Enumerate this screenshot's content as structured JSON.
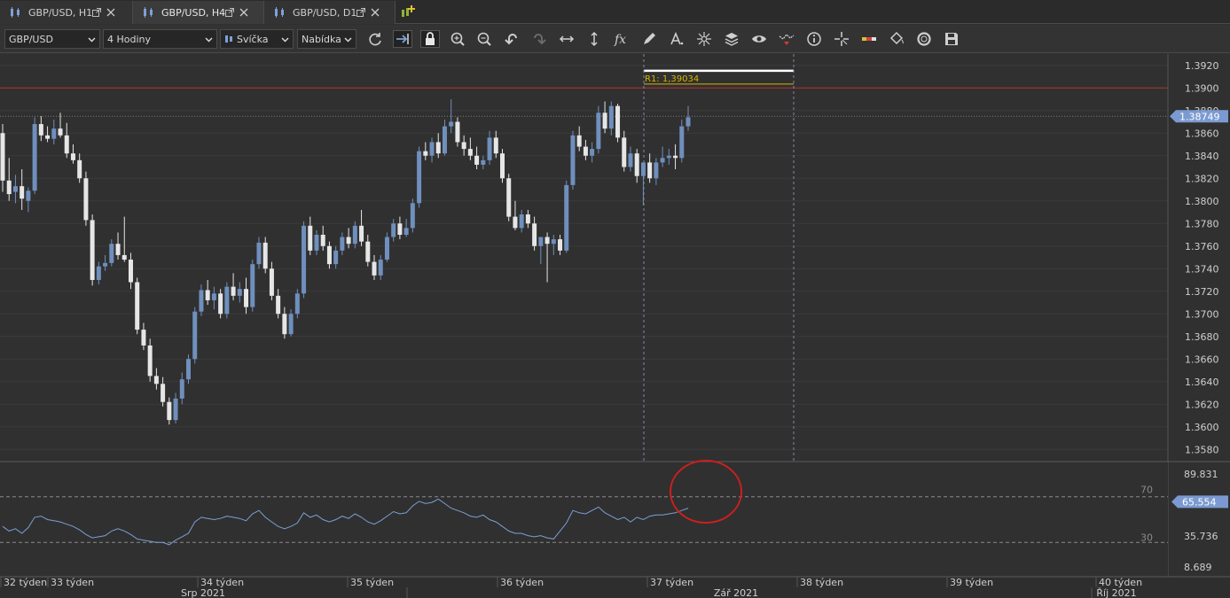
{
  "tabs": [
    {
      "label": "GBP/USD, H1",
      "active": false
    },
    {
      "label": "GBP/USD, H4",
      "active": true
    },
    {
      "label": "GBP/USD, D1",
      "active": false
    }
  ],
  "toolbar": {
    "instrument": "GBP/USD",
    "period": "4 Hodiny",
    "chart_type": "Svíčka",
    "price_side": "Nabídka",
    "icons": [
      "refresh-icon",
      "shift-chart-icon",
      "lock-icon",
      "zoom-in-icon",
      "zoom-out-icon",
      "undo-icon",
      "redo-icon",
      "horizontal-arrows-icon",
      "vertical-arrows-icon",
      "function-icon",
      "pencil-icon",
      "text-icon",
      "crosshair-star-icon",
      "layers-icon",
      "eye-icon",
      "indicator-alert-icon",
      "info-icon",
      "cursor-cross-icon",
      "color-bar-icon",
      "paint-bucket-icon",
      "target-ring-icon",
      "save-icon"
    ]
  },
  "colors": {
    "background": "#303030",
    "bull_candle": "#6f8fbd",
    "bear_candle": "#e6e6e6",
    "resistance_line": "#d9b300",
    "red_level": "#b03030",
    "rsi_line": "#7c9fd4",
    "highlight_circle": "#cc1f1f",
    "price_badge": "#7b9ad1"
  },
  "price_axis": {
    "labels": [
      "1.3920",
      "1.3900",
      "1.3880",
      "1.3860",
      "1.3840",
      "1.3820",
      "1.3800",
      "1.3780",
      "1.3760",
      "1.3740",
      "1.3720",
      "1.3700",
      "1.3680",
      "1.3660",
      "1.3640",
      "1.3620",
      "1.3600",
      "1.3580"
    ],
    "current_price": "1.38749"
  },
  "resistance": {
    "label": "R1: 1,39034"
  },
  "red_level_value": 1.39,
  "rsi": {
    "level_high": "70",
    "level_low": "30",
    "axis_labels": [
      "89.831",
      "35.736",
      "8.689"
    ],
    "current_value": "65.554"
  },
  "time_axis": {
    "weeks": [
      "32 týden",
      "33 týden",
      "34 týden",
      "35 týden",
      "36 týden",
      "37 týden",
      "38 týden",
      "39 týden",
      "40 týden"
    ],
    "months": [
      "Srp 2021",
      "Zář 2021",
      "Říj 2021"
    ]
  },
  "chart_data": {
    "type": "candlestick",
    "instrument": "GBP/USD",
    "timeframe": "4 Hodiny",
    "ylim": [
      1.357,
      1.393
    ],
    "candles": [
      [
        1.386,
        1.3868,
        1.3808,
        1.3818
      ],
      [
        1.3818,
        1.3838,
        1.38,
        1.3806
      ],
      [
        1.3808,
        1.3823,
        1.3798,
        1.3813
      ],
      [
        1.3813,
        1.3828,
        1.3792,
        1.3802
      ],
      [
        1.38,
        1.3812,
        1.379,
        1.3809
      ],
      [
        1.3809,
        1.3874,
        1.3806,
        1.3868
      ],
      [
        1.3868,
        1.3875,
        1.3853,
        1.3858
      ],
      [
        1.3858,
        1.3866,
        1.3852,
        1.3855
      ],
      [
        1.3855,
        1.3872,
        1.385,
        1.3864
      ],
      [
        1.3864,
        1.3878,
        1.3856,
        1.3858
      ],
      [
        1.3858,
        1.3869,
        1.3838,
        1.3842
      ],
      [
        1.3842,
        1.385,
        1.3833,
        1.3836
      ],
      [
        1.3836,
        1.3842,
        1.3816,
        1.382
      ],
      [
        1.382,
        1.3826,
        1.3778,
        1.3783
      ],
      [
        1.3783,
        1.3788,
        1.3725,
        1.373
      ],
      [
        1.373,
        1.3746,
        1.3726,
        1.3742
      ],
      [
        1.3742,
        1.3752,
        1.3738,
        1.3745
      ],
      [
        1.3745,
        1.3766,
        1.3742,
        1.3762
      ],
      [
        1.3762,
        1.3772,
        1.3748,
        1.3752
      ],
      [
        1.3752,
        1.3786,
        1.3746,
        1.3748
      ],
      [
        1.3748,
        1.3754,
        1.3722,
        1.3728
      ],
      [
        1.3728,
        1.3732,
        1.3682,
        1.3686
      ],
      [
        1.3686,
        1.3692,
        1.3668,
        1.3672
      ],
      [
        1.3672,
        1.3678,
        1.364,
        1.3645
      ],
      [
        1.3645,
        1.3652,
        1.3633,
        1.3638
      ],
      [
        1.3638,
        1.3644,
        1.3618,
        1.3622
      ],
      [
        1.3622,
        1.3626,
        1.3602,
        1.3606
      ],
      [
        1.3606,
        1.363,
        1.3603,
        1.3625
      ],
      [
        1.3625,
        1.3648,
        1.362,
        1.3642
      ],
      [
        1.3642,
        1.3664,
        1.3638,
        1.366
      ],
      [
        1.366,
        1.3706,
        1.3656,
        1.3702
      ],
      [
        1.3702,
        1.3726,
        1.3698,
        1.3721
      ],
      [
        1.3721,
        1.373,
        1.3708,
        1.3712
      ],
      [
        1.3712,
        1.3724,
        1.3704,
        1.3718
      ],
      [
        1.3718,
        1.3722,
        1.3696,
        1.37
      ],
      [
        1.37,
        1.3728,
        1.3696,
        1.3724
      ],
      [
        1.3724,
        1.3736,
        1.3712,
        1.3716
      ],
      [
        1.3716,
        1.3728,
        1.371,
        1.3722
      ],
      [
        1.3722,
        1.3732,
        1.37,
        1.3706
      ],
      [
        1.3706,
        1.3748,
        1.3702,
        1.3744
      ],
      [
        1.3744,
        1.3768,
        1.374,
        1.3763
      ],
      [
        1.3763,
        1.3768,
        1.3736,
        1.374
      ],
      [
        1.374,
        1.3746,
        1.3712,
        1.3716
      ],
      [
        1.3716,
        1.3722,
        1.3696,
        1.37
      ],
      [
        1.37,
        1.3706,
        1.3678,
        1.3682
      ],
      [
        1.3682,
        1.3704,
        1.368,
        1.37
      ],
      [
        1.37,
        1.3722,
        1.3696,
        1.3718
      ],
      [
        1.3718,
        1.3782,
        1.3714,
        1.3778
      ],
      [
        1.3778,
        1.3786,
        1.3752,
        1.3756
      ],
      [
        1.3756,
        1.3774,
        1.3752,
        1.377
      ],
      [
        1.377,
        1.3778,
        1.3756,
        1.376
      ],
      [
        1.376,
        1.3764,
        1.374,
        1.3744
      ],
      [
        1.3744,
        1.376,
        1.374,
        1.3756
      ],
      [
        1.3756,
        1.3772,
        1.3752,
        1.3768
      ],
      [
        1.3768,
        1.3776,
        1.3758,
        1.3762
      ],
      [
        1.3762,
        1.3782,
        1.3758,
        1.3778
      ],
      [
        1.3778,
        1.3792,
        1.376,
        1.3764
      ],
      [
        1.3764,
        1.377,
        1.3742,
        1.3746
      ],
      [
        1.3746,
        1.3752,
        1.373,
        1.3734
      ],
      [
        1.3734,
        1.3752,
        1.373,
        1.3748
      ],
      [
        1.3748,
        1.3772,
        1.3746,
        1.3768
      ],
      [
        1.3768,
        1.3784,
        1.3764,
        1.378
      ],
      [
        1.378,
        1.3786,
        1.3766,
        1.377
      ],
      [
        1.377,
        1.3784,
        1.3768,
        1.3776
      ],
      [
        1.3776,
        1.3802,
        1.3772,
        1.3798
      ],
      [
        1.3798,
        1.3848,
        1.3794,
        1.3844
      ],
      [
        1.3844,
        1.3852,
        1.3836,
        1.384
      ],
      [
        1.384,
        1.3856,
        1.3834,
        1.3852
      ],
      [
        1.3852,
        1.386,
        1.3838,
        1.3842
      ],
      [
        1.3842,
        1.3872,
        1.384,
        1.3866
      ],
      [
        1.3866,
        1.389,
        1.386,
        1.387
      ],
      [
        1.387,
        1.3874,
        1.3848,
        1.3852
      ],
      [
        1.3852,
        1.3858,
        1.384,
        1.3846
      ],
      [
        1.3846,
        1.3856,
        1.3836,
        1.384
      ],
      [
        1.384,
        1.3848,
        1.3828,
        1.3832
      ],
      [
        1.3832,
        1.384,
        1.3828,
        1.3836
      ],
      [
        1.3836,
        1.3862,
        1.3832,
        1.3856
      ],
      [
        1.3856,
        1.3862,
        1.3838,
        1.3842
      ],
      [
        1.3842,
        1.3846,
        1.3816,
        1.382
      ],
      [
        1.382,
        1.3824,
        1.3782,
        1.3786
      ],
      [
        1.3786,
        1.38,
        1.3774,
        1.3776
      ],
      [
        1.3776,
        1.3792,
        1.3772,
        1.3788
      ],
      [
        1.3788,
        1.3792,
        1.3776,
        1.378
      ],
      [
        1.378,
        1.3786,
        1.3756,
        1.376
      ],
      [
        1.376,
        1.3766,
        1.3744,
        1.3768
      ],
      [
        1.3768,
        1.3772,
        1.3728,
        1.3762
      ],
      [
        1.3762,
        1.377,
        1.3752,
        1.3766
      ],
      [
        1.3766,
        1.377,
        1.3752,
        1.3756
      ],
      [
        1.3756,
        1.3818,
        1.3754,
        1.3814
      ],
      [
        1.3814,
        1.3862,
        1.381,
        1.3858
      ],
      [
        1.3858,
        1.3866,
        1.3844,
        1.3848
      ],
      [
        1.3848,
        1.3854,
        1.3836,
        1.384
      ],
      [
        1.384,
        1.3852,
        1.3834,
        1.3846
      ],
      [
        1.3846,
        1.3884,
        1.3842,
        1.3878
      ],
      [
        1.3878,
        1.3888,
        1.386,
        1.3864
      ],
      [
        1.3864,
        1.3888,
        1.3858,
        1.3884
      ],
      [
        1.3884,
        1.3886,
        1.3852,
        1.3856
      ],
      [
        1.3856,
        1.3862,
        1.3826,
        1.383
      ],
      [
        1.383,
        1.3848,
        1.3826,
        1.3842
      ],
      [
        1.3842,
        1.3846,
        1.3816,
        1.3822
      ],
      [
        1.3822,
        1.383,
        1.3796,
        1.3834
      ],
      [
        1.3834,
        1.3842,
        1.3816,
        1.382
      ],
      [
        1.382,
        1.3838,
        1.3814,
        1.3834
      ],
      [
        1.3834,
        1.3848,
        1.383,
        1.3838
      ],
      [
        1.3838,
        1.3846,
        1.3832,
        1.384
      ],
      [
        1.384,
        1.385,
        1.3828,
        1.3838
      ],
      [
        1.3838,
        1.3872,
        1.3834,
        1.3866
      ],
      [
        1.3866,
        1.3884,
        1.3862,
        1.3874
      ]
    ],
    "rsi_values": [
      44,
      40,
      42,
      38,
      43,
      52,
      53,
      50,
      49,
      48,
      46,
      44,
      41,
      37,
      34,
      35,
      36,
      40,
      42,
      40,
      37,
      33,
      32,
      31,
      30,
      30,
      28,
      32,
      35,
      38,
      48,
      52,
      51,
      50,
      51,
      53,
      52,
      51,
      49,
      55,
      58,
      52,
      48,
      44,
      42,
      44,
      47,
      56,
      52,
      54,
      50,
      48,
      50,
      53,
      51,
      55,
      52,
      48,
      46,
      49,
      53,
      57,
      55,
      56,
      62,
      66,
      64,
      65,
      68,
      64,
      60,
      58,
      56,
      53,
      52,
      54,
      50,
      48,
      44,
      40,
      38,
      38,
      36,
      35,
      36,
      34,
      33,
      40,
      47,
      58,
      56,
      55,
      58,
      61,
      56,
      53,
      50,
      52,
      48,
      52,
      50,
      53,
      54,
      54,
      55,
      56,
      58,
      60
    ],
    "rsi_levels": [
      70,
      30
    ],
    "rsi_ylim": [
      0,
      100
    ],
    "resistance_value": 1.39034,
    "current_price": 1.38749,
    "rsi_current": 65.554
  }
}
